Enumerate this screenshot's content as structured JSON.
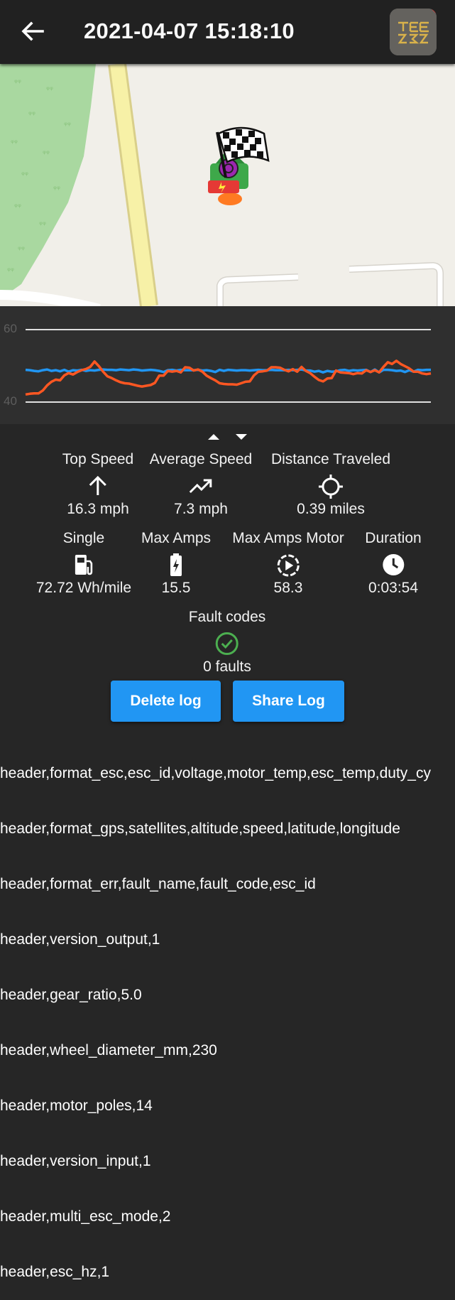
{
  "appbar": {
    "title": "2021-04-07 15:18:10",
    "back_icon": "arrow-left-icon",
    "logo_icon": "app-logo"
  },
  "chart_data": {
    "type": "line",
    "ylim": [
      40,
      60
    ],
    "yticks": [
      "60",
      "40"
    ],
    "grid": true,
    "series": [
      {
        "color": "#2196f3",
        "values": [
          48.9,
          48.8,
          48.6,
          48.5,
          48.8,
          49.0,
          48.6,
          48.8,
          48.5,
          48.9,
          48.4,
          48.8,
          48.7,
          48.9,
          48.6,
          48.8,
          48.7,
          48.9,
          49.0,
          48.9,
          48.9,
          48.8,
          49.0,
          48.9,
          48.8,
          49.0,
          48.9,
          48.7,
          48.8,
          48.9,
          48.8,
          48.6,
          48.3,
          48.8,
          48.9,
          48.7,
          48.9,
          48.8,
          48.8,
          48.8,
          48.9,
          48.7,
          48.8,
          48.6,
          48.3,
          48.9,
          48.6,
          48.9,
          48.8,
          48.7,
          48.8,
          48.8,
          48.7,
          48.8,
          48.9,
          48.8,
          48.8,
          48.9,
          48.8,
          48.8,
          48.8,
          48.9,
          48.8,
          48.9,
          49.0,
          48.7,
          48.7,
          48.4,
          48.6,
          48.2,
          48.6,
          48.4,
          48.5,
          48.8,
          48.9,
          48.6,
          48.8,
          48.7,
          48.8,
          48.9,
          48.3,
          49.0,
          48.2,
          48.9,
          48.9,
          48.8,
          48.6,
          48.7,
          48.3,
          48.8,
          48.4,
          48.9,
          48.8,
          48.9,
          48.9
        ]
      },
      {
        "color": "#ff5722",
        "values": [
          42.1,
          42.3,
          42.4,
          42.4,
          43.2,
          44.6,
          45.6,
          46.2,
          46.0,
          47.4,
          48.0,
          47.6,
          48.3,
          48.8,
          49.1,
          49.7,
          51.2,
          49.9,
          48.4,
          47.1,
          46.6,
          46.0,
          45.5,
          45.2,
          45.1,
          44.8,
          44.5,
          44.3,
          44.5,
          44.7,
          45.3,
          47.3,
          47.3,
          48.6,
          48.4,
          48.6,
          48.2,
          49.6,
          49.5,
          48.7,
          49.0,
          48.4,
          47.3,
          46.6,
          46.0,
          45.2,
          45.0,
          44.9,
          44.9,
          44.8,
          45.2,
          45.6,
          45.7,
          47.4,
          48.4,
          48.5,
          48.7,
          49.6,
          49.6,
          49.5,
          48.9,
          48.5,
          49.1,
          48.4,
          49.7,
          48.6,
          48.0,
          47.0,
          46.1,
          45.7,
          46.5,
          46.6,
          48.7,
          48.2,
          48.1,
          48.0,
          47.7,
          48.0,
          47.9,
          48.8,
          48.3,
          48.8,
          48.2,
          49.7,
          51.0,
          50.5,
          51.4,
          50.5,
          49.9,
          49.3,
          48.4,
          48.4,
          47.9,
          47.7,
          47.9
        ]
      }
    ]
  },
  "stats_row1": [
    {
      "label": "Top Speed",
      "icon": "arrow-up-icon",
      "value": "16.3 mph"
    },
    {
      "label": "Average Speed",
      "icon": "trending-up-icon",
      "value": "7.3 mph"
    },
    {
      "label": "Distance Traveled",
      "icon": "gps-crosshair-icon",
      "value": "0.39 miles"
    }
  ],
  "stats_row2": [
    {
      "label": "Single",
      "icon": "fuel-pump-icon",
      "value": "72.72 Wh/mile"
    },
    {
      "label": "Max Amps",
      "icon": "battery-charging-icon",
      "value": "15.5"
    },
    {
      "label": "Max Amps Motor",
      "icon": "motor-dial-icon",
      "value": "58.3"
    },
    {
      "label": "Duration",
      "icon": "clock-icon",
      "value": "0:03:54"
    }
  ],
  "faults": {
    "label": "Fault codes",
    "icon": "check-circle-icon",
    "value": "0 faults"
  },
  "buttons": {
    "delete": "Delete log",
    "share": "Share Log"
  },
  "log_lines": [
    "header,format_esc,esc_id,voltage,motor_temp,esc_temp,duty_cy",
    "header,format_gps,satellites,altitude,speed,latitude,longitude",
    "header,format_err,fault_name,fault_code,esc_id",
    "header,version_output,1",
    "header,gear_ratio,5.0",
    "header,wheel_diameter_mm,230",
    "header,motor_poles,14",
    "header,version_input,1",
    "header,multi_esc_mode,2",
    "header,esc_hz,1"
  ],
  "colors": {
    "accent": "#2196f3",
    "speed_line": "#2196f3",
    "second_line": "#ff5722",
    "success": "#4caf50",
    "background": "#262626"
  }
}
